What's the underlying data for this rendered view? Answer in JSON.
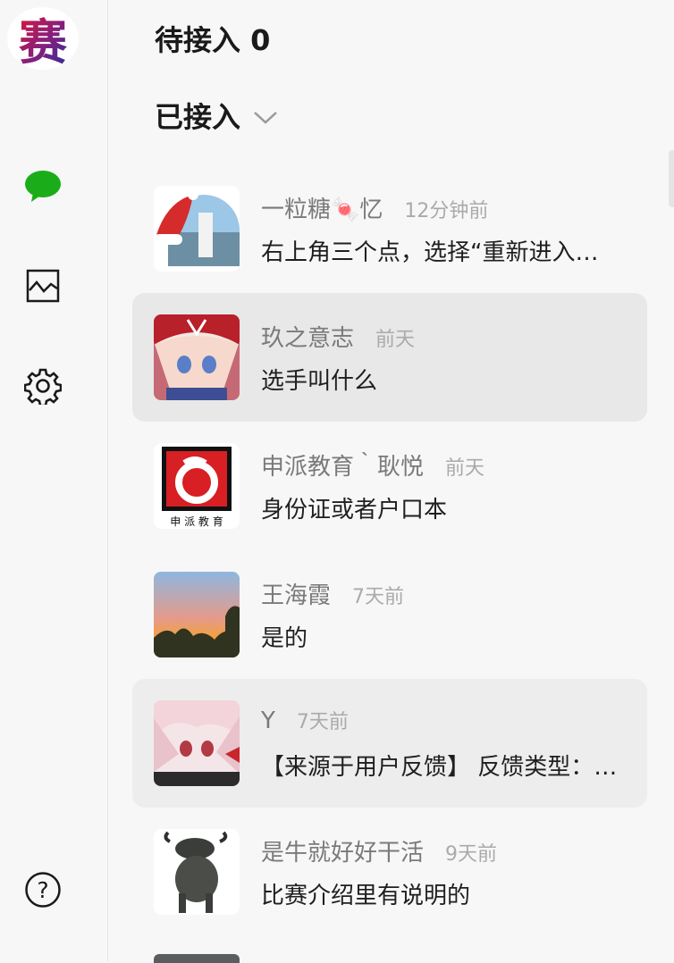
{
  "sidebar": {
    "logo_alt": "赛",
    "items": [
      {
        "name": "chat-icon"
      },
      {
        "name": "chart-icon"
      },
      {
        "name": "gear-icon"
      }
    ],
    "help_icon": "help-icon",
    "accent": "#1aad19"
  },
  "header": {
    "pending_label": "待接入 0",
    "accepted_label": "已接入"
  },
  "conversations": [
    {
      "name": "一粒糖🍬忆",
      "time": "12分钟前",
      "message": "右上角三个点，选择“重新进入小程序”"
    },
    {
      "name": "玖之意志",
      "time": "前天",
      "message": "选手叫什么"
    },
    {
      "name": "申派教育｀耿悦",
      "time": "前天",
      "message": "身份证或者户口本"
    },
    {
      "name": "王海霞",
      "time": "7天前",
      "message": "是的"
    },
    {
      "name": "Y",
      "time": "7天前",
      "message": "【来源于用户反馈】 反馈类型：其他"
    },
    {
      "name": "是牛就好好干活",
      "time": "9天前",
      "message": "比赛介绍里有说明的"
    }
  ],
  "avatar_text": {
    "shenpai": "申 派 教 育"
  }
}
